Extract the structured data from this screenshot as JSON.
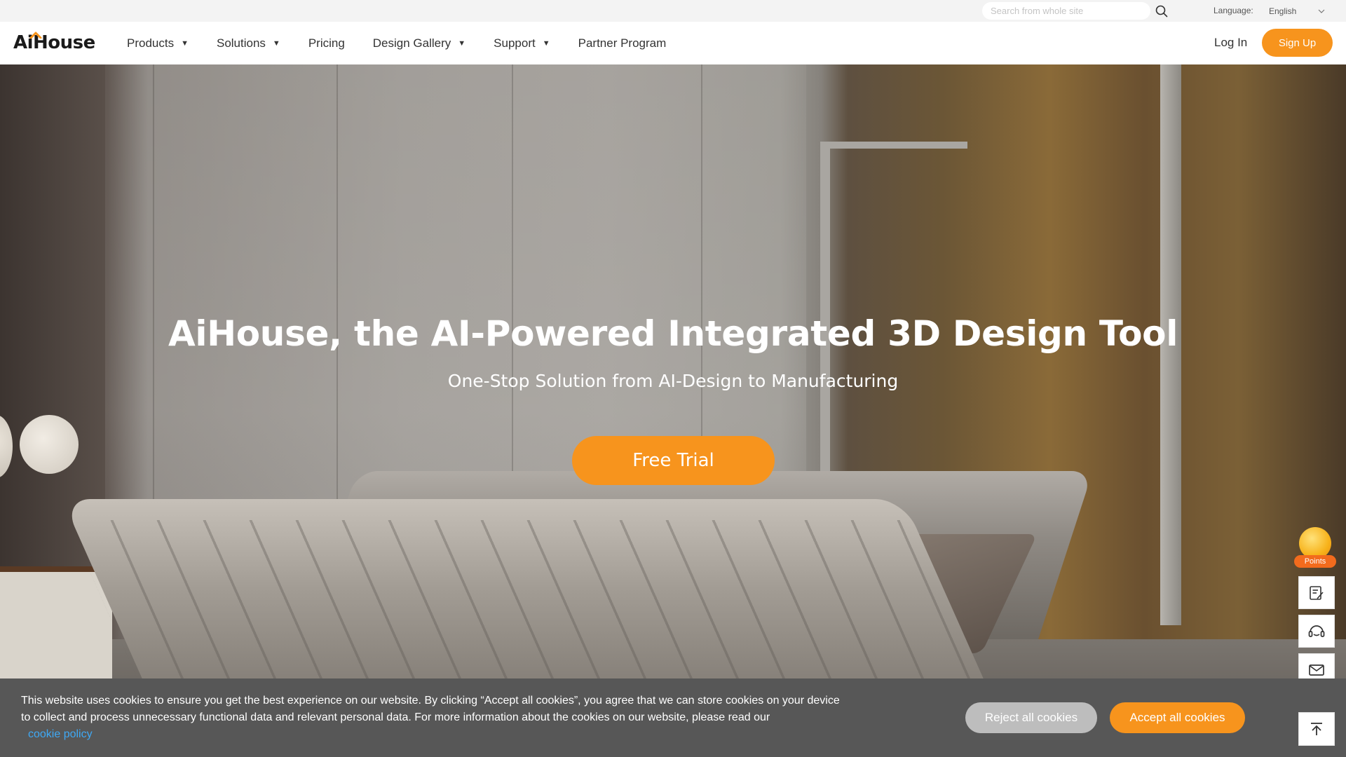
{
  "utility": {
    "search_placeholder": "Search from whole site",
    "language_label": "Language:",
    "language_value": "English"
  },
  "nav": {
    "logo": "AiHouse",
    "items": [
      {
        "label": "Products",
        "has_dropdown": true
      },
      {
        "label": "Solutions",
        "has_dropdown": true
      },
      {
        "label": "Pricing",
        "has_dropdown": false
      },
      {
        "label": "Design Gallery",
        "has_dropdown": true
      },
      {
        "label": "Support",
        "has_dropdown": true
      },
      {
        "label": "Partner Program",
        "has_dropdown": false
      }
    ],
    "login": "Log In",
    "signup": "Sign Up"
  },
  "hero": {
    "title": "AiHouse, the AI-Powered Integrated 3D Design Tool",
    "subtitle": "One-Stop Solution from AI-Design to Manufacturing",
    "cta": "Free Trial"
  },
  "side_tools": {
    "points_label": "Points",
    "icons": [
      "form-edit-icon",
      "headset-icon",
      "mail-icon"
    ]
  },
  "cookie": {
    "text": "This website uses cookies to ensure you get the best experience on our website. By clicking “Accept all cookies”, you agree that we can store cookies on your device to collect and process unnecessary functional data and relevant personal data. For more information about the cookies on our website, please read our",
    "link": "cookie policy",
    "reject": "Reject all cookies",
    "accept": "Accept all cookies"
  },
  "colors": {
    "accent": "#f7941d",
    "link": "#3fa9f5",
    "banner_bg": "#575757",
    "reject_bg": "#bdbdbd"
  }
}
